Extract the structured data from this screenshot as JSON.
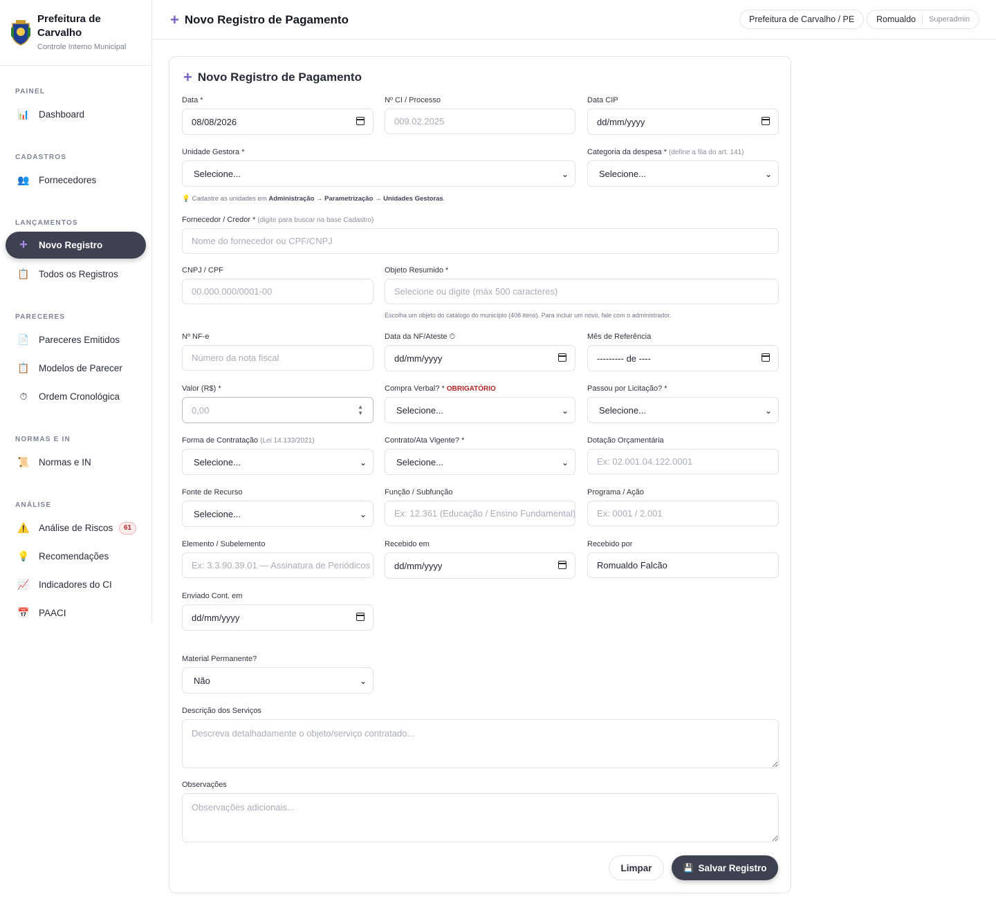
{
  "brand": {
    "title": "Prefeitura de Carvalho",
    "subtitle": "Controle Interno Municipal"
  },
  "sidebar": {
    "sections": [
      {
        "title": "PAINEL",
        "items": [
          {
            "label": "Dashboard",
            "icon": "bar-chart-icon"
          }
        ]
      },
      {
        "title": "CADASTROS",
        "items": [
          {
            "label": "Fornecedores",
            "icon": "people-icon"
          }
        ]
      },
      {
        "title": "LANÇAMENTOS",
        "items": [
          {
            "label": "Novo Registro",
            "icon": "plus-icon",
            "active": true
          },
          {
            "label": "Todos os Registros",
            "icon": "clipboard-icon"
          }
        ]
      },
      {
        "title": "PARECERES",
        "items": [
          {
            "label": "Pareceres Emitidos",
            "icon": "document-icon"
          },
          {
            "label": "Modelos de Parecer",
            "icon": "clipboard-icon"
          },
          {
            "label": "Ordem Cronológica",
            "icon": "stopwatch-icon"
          }
        ]
      },
      {
        "title": "NORMAS E IN",
        "items": [
          {
            "label": "Normas e IN",
            "icon": "scroll-icon"
          }
        ]
      },
      {
        "title": "ANÁLISE",
        "items": [
          {
            "label": "Análise de Riscos",
            "icon": "warning-icon",
            "badge": "61"
          },
          {
            "label": "Recomendações",
            "icon": "lightbulb-icon"
          },
          {
            "label": "Indicadores do CI",
            "icon": "line-chart-icon"
          },
          {
            "label": "PAACI",
            "icon": "calendar-icon"
          }
        ]
      }
    ]
  },
  "header": {
    "title": "Novo Registro de Pagamento",
    "org": "Prefeitura de Carvalho / PE",
    "user": "Romualdo",
    "role": "Superadmin"
  },
  "form": {
    "title": "Novo Registro de Pagamento",
    "data": {
      "label": "Data *",
      "value": "08/08/2026"
    },
    "ci": {
      "label": "Nº CI / Processo",
      "placeholder": "009.02.2025"
    },
    "data_cip": {
      "label": "Data CIP",
      "value": "dd/mm/yyyy"
    },
    "unidade": {
      "label": "Unidade Gestora *",
      "value": "Selecione..."
    },
    "categoria": {
      "label": "Categoria da despesa *",
      "note": "(define a fila do art. 141)",
      "value": "Selecione..."
    },
    "unidade_hint": {
      "pre": "Cadastre as unidades em",
      "path": "Administração → Parametrização → Unidades Gestoras",
      "post": "."
    },
    "fornecedor": {
      "label": "Fornecedor / Credor *",
      "note": "(digite para buscar na base Cadastro)",
      "placeholder": "Nome do fornecedor ou CPF/CNPJ"
    },
    "cnpj": {
      "label": "CNPJ / CPF",
      "placeholder": "00.000.000/0001-00"
    },
    "objeto": {
      "label": "Objeto Resumido *",
      "placeholder": "Selecione ou digite (máx 500 caracteres)",
      "hint": "Escolha um objeto do catálogo do município (408 itens). Para incluir um novo, fale com o administrador."
    },
    "nfe": {
      "label": "Nº NF-e",
      "placeholder": "Número da nota fiscal"
    },
    "data_nf": {
      "label": "Data da NF/Ateste",
      "value": "dd/mm/yyyy"
    },
    "mes_ref": {
      "label": "Mês de Referência",
      "value": "--------- de ----"
    },
    "valor": {
      "label": "Valor (R$) *",
      "placeholder": "0,00"
    },
    "compra_verbal": {
      "label": "Compra Verbal? *",
      "required_tag": "OBRIGATÓRIO",
      "value": "Selecione..."
    },
    "licitacao": {
      "label": "Passou por Licitação? *",
      "value": "Selecione..."
    },
    "forma": {
      "label": "Forma de Contratação",
      "note": "(Lei 14.133/2021)",
      "value": "Selecione..."
    },
    "contrato": {
      "label": "Contrato/Ata Vigente? *",
      "value": "Selecione..."
    },
    "dotacao": {
      "label": "Dotação Orçamentária",
      "placeholder": "Ex: 02.001.04.122.0001"
    },
    "fonte": {
      "label": "Fonte de Recurso",
      "value": "Selecione..."
    },
    "funcao": {
      "label": "Função / Subfunção",
      "placeholder": "Ex: 12.361 (Educação / Ensino Fundamental)"
    },
    "programa": {
      "label": "Programa / Ação",
      "placeholder": "Ex: 0001 / 2.001"
    },
    "elemento": {
      "label": "Elemento / Subelemento",
      "placeholder": "Ex: 3.3.90.39.01 — Assinatura de Periódicos"
    },
    "recebido_em": {
      "label": "Recebido em",
      "value": "dd/mm/yyyy"
    },
    "recebido_por": {
      "label": "Recebido por",
      "value": "Romualdo Falcão"
    },
    "enviado": {
      "label": "Enviado Cont. em",
      "value": "dd/mm/yyyy"
    },
    "material": {
      "label": "Material Permanente?",
      "value": "Não"
    },
    "descricao": {
      "label": "Descrição dos Serviços",
      "placeholder": "Descreva detalhadamente o objeto/serviço contratado..."
    },
    "observacoes": {
      "label": "Observações",
      "placeholder": "Observações adicionais..."
    },
    "clear_label": "Limpar",
    "save_label": "Salvar Registro"
  }
}
